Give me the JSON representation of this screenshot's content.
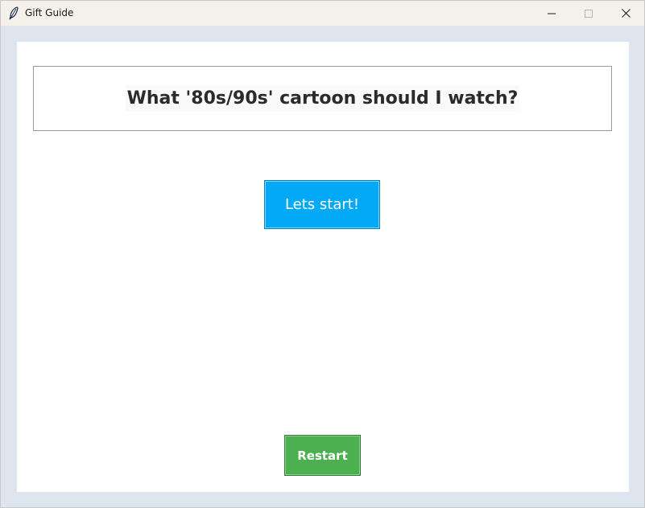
{
  "window": {
    "title": "Gift Guide",
    "app_icon": "feather-icon",
    "controls": {
      "minimize_icon": "minimize-icon",
      "maximize_icon": "maximize-icon",
      "close_icon": "close-icon"
    }
  },
  "main": {
    "question": "What '80s/90s' cartoon should I watch?",
    "start_label": "Lets start!",
    "restart_label": "Restart"
  },
  "colors": {
    "window_bg": "#dfe5ee",
    "titlebar_bg": "#f4f1ea",
    "start_button": "#03a9f4",
    "restart_button": "#4caf50"
  }
}
